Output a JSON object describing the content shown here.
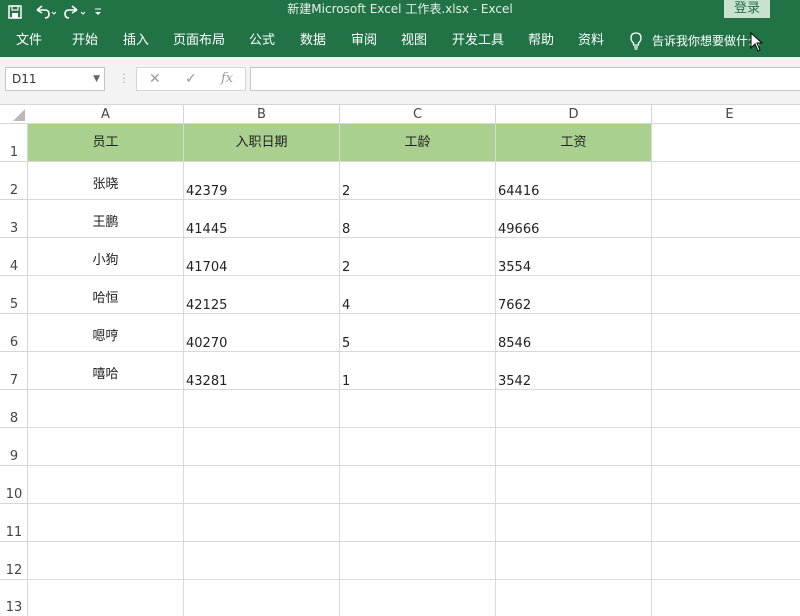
{
  "window": {
    "title": "新建Microsoft Excel 工作表.xlsx  -  Excel",
    "login_label": "登录"
  },
  "qat": {
    "icons": [
      "save-icon",
      "undo-icon",
      "redo-icon",
      "customize-icon"
    ]
  },
  "ribbon": {
    "tabs": [
      "文件",
      "开始",
      "插入",
      "页面布局",
      "公式",
      "数据",
      "审阅",
      "视图",
      "开发工具",
      "帮助",
      "资料"
    ],
    "tellme": "告诉我你想要做什么"
  },
  "formula_bar": {
    "name_box": "D11",
    "fx_label": "fx",
    "cancel": "✕",
    "enter": "✓",
    "content": ""
  },
  "columns": [
    "A",
    "B",
    "C",
    "D",
    "E"
  ],
  "rows": [
    "1",
    "2",
    "3",
    "4",
    "5",
    "6",
    "7",
    "8",
    "9",
    "10",
    "11",
    "12",
    "13"
  ],
  "table": {
    "headers": [
      "员工",
      "入职日期",
      "工龄",
      "工资"
    ],
    "header_fill": "#A9D08E",
    "records": [
      {
        "name": "张晓",
        "date": "42379",
        "years": "2",
        "salary": "64416"
      },
      {
        "name": "王鹏",
        "date": "41445",
        "years": "8",
        "salary": "49666"
      },
      {
        "name": "小狗",
        "date": "41704",
        "years": "2",
        "salary": "3554"
      },
      {
        "name": "哈恒",
        "date": "42125",
        "years": "4",
        "salary": "7662"
      },
      {
        "name": "嗯哼",
        "date": "40270",
        "years": "5",
        "salary": "8546"
      },
      {
        "name": "嘻哈",
        "date": "43281",
        "years": "1",
        "salary": "3542"
      }
    ]
  },
  "colors": {
    "accent": "#217346",
    "header_fill": "#A9D08E",
    "gridline": "#D9D9D9"
  }
}
